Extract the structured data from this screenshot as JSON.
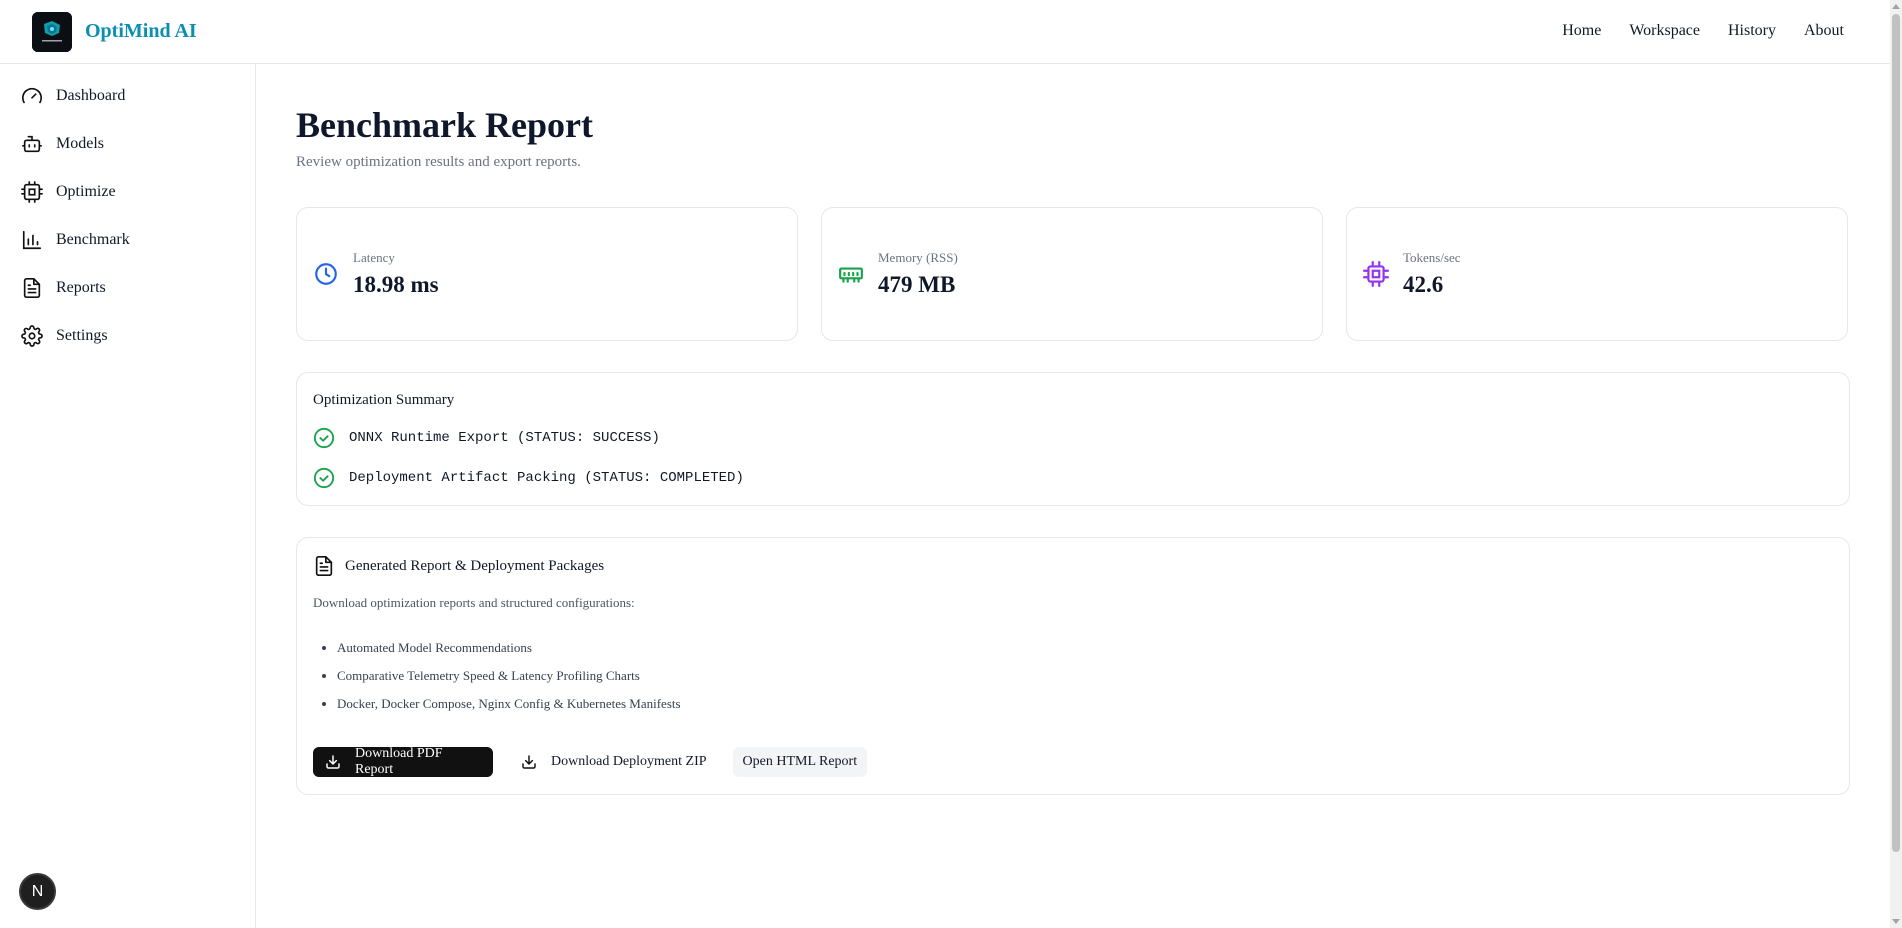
{
  "header": {
    "brand": "OptiMind AI",
    "nav": [
      "Home",
      "Workspace",
      "History",
      "About"
    ]
  },
  "sidebar": {
    "items": [
      {
        "label": "Dashboard",
        "icon": "gauge-icon"
      },
      {
        "label": "Models",
        "icon": "bot-icon"
      },
      {
        "label": "Optimize",
        "icon": "cpu-icon"
      },
      {
        "label": "Benchmark",
        "icon": "bar-chart-icon"
      },
      {
        "label": "Reports",
        "icon": "file-text-icon"
      },
      {
        "label": "Settings",
        "icon": "gear-icon"
      }
    ],
    "badge": "N"
  },
  "page": {
    "title": "Benchmark Report",
    "subtitle": "Review optimization results and export reports."
  },
  "metrics": [
    {
      "label": "Latency",
      "value": "18.98 ms",
      "icon": "clock-icon",
      "color": "#2563eb"
    },
    {
      "label": "Memory (RSS)",
      "value": "479 MB",
      "icon": "memory-icon",
      "color": "#16a34a"
    },
    {
      "label": "Tokens/sec",
      "value": "42.6",
      "icon": "cpu-icon",
      "color": "#9333ea"
    }
  ],
  "summary": {
    "title": "Optimization Summary",
    "rows": [
      "ONNX Runtime Export (STATUS: SUCCESS)",
      "Deployment Artifact Packing (STATUS: COMPLETED)"
    ],
    "status_color": "#16a34a"
  },
  "reports": {
    "title": "Generated Report & Deployment Packages",
    "description": "Download optimization reports and structured configurations:",
    "items": [
      "Automated Model Recommendations",
      "Comparative Telemetry Speed & Latency Profiling Charts",
      "Docker, Docker Compose, Nginx Config & Kubernetes Manifests"
    ],
    "buttons": {
      "pdf": "Download PDF Report",
      "zip": "Download Deployment ZIP",
      "html": "Open HTML Report"
    }
  }
}
